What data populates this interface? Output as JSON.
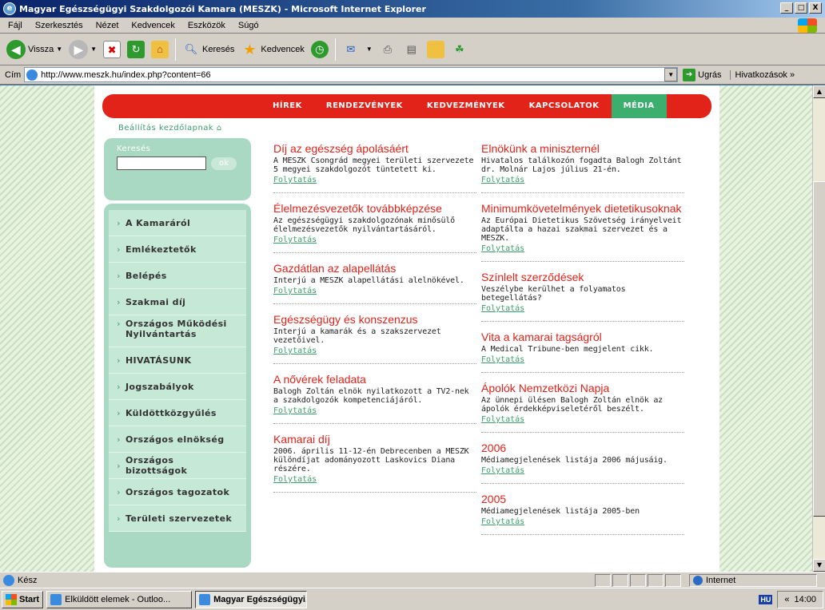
{
  "window": {
    "title": "Magyar Egészségügyi Szakdolgozói Kamara (MESZK) - Microsoft Internet Explorer",
    "minimize": "_",
    "maximize": "□",
    "close": "X"
  },
  "menu": [
    "Fájl",
    "Szerkesztés",
    "Nézet",
    "Kedvencek",
    "Eszközök",
    "Súgó"
  ],
  "toolbar": {
    "back_label": "Vissza",
    "search_label": "Keresés",
    "favorites_label": "Kedvencek"
  },
  "address": {
    "label": "Cím",
    "url": "http://www.meszk.hu/index.php?content=66",
    "go_label": "Ugrás",
    "links_label": "Hivatkozások",
    "links_more": "»"
  },
  "topnav": {
    "items": [
      {
        "label": "HÍREK",
        "active": false
      },
      {
        "label": "RENDEZVÉNYEK",
        "active": false
      },
      {
        "label": "KEDVEZMÉNYEK",
        "active": false
      },
      {
        "label": "KAPCSOLATOK",
        "active": false
      },
      {
        "label": "MÉDIA",
        "active": true
      }
    ]
  },
  "homepage_link": "Beállítás kezdőlapnak",
  "search": {
    "label": "Keresés",
    "button": "ok"
  },
  "sidebar": {
    "items": [
      "A Kamaráról",
      "Emlékeztetők",
      "Belépés",
      "Szakmai díj",
      "Országos Működési Nyilvántartás",
      "HIVATÁSUNK",
      "Jogszabályok",
      "Küldöttközgyűlés",
      "Országos elnökség",
      "Országos bizottságok",
      "Országos tagozatok",
      "Területi szervezetek"
    ]
  },
  "news": {
    "more_label": "Folytatás",
    "left": [
      {
        "title": "Díj az egészség ápolásáért",
        "body": "A MESZK Csongrád megyei területi szervezete 5 megyei szakdolgozót tüntetett ki."
      },
      {
        "title": "Élelmezésvezetők továbbképzése",
        "body": "Az egészségügyi szakdolgozónak minősülő élelmezésvezetők nyilvántartásáról."
      },
      {
        "title": "Gazdátlan az alapellátás",
        "body": "Interjú a MESZK alapellátási alelnökével."
      },
      {
        "title": "Egészségügy és konszenzus",
        "body": "Interjú a kamarák és a szakszervezet vezetőivel."
      },
      {
        "title": "A nővérek feladata",
        "body": "Balogh Zoltán elnök nyilatkozott a TV2-nek a szakdolgozók kompetenciájáról."
      },
      {
        "title": "Kamarai díj",
        "body": "2006. április 11-12-én Debrecenben a MESZK különdíjat adományozott Laskovics Diana részére."
      }
    ],
    "right": [
      {
        "title": "Elnökünk a miniszternél",
        "body": "Hivatalos találkozón fogadta Balogh Zoltánt dr. Molnár Lajos július 21-én."
      },
      {
        "title": "Minimumkövetelmények dietetikusoknak",
        "body": "Az Európai Dietetikus Szövetség irányelveit adaptálta a hazai szakmai szervezet és a MESZK."
      },
      {
        "title": "Színlelt szerződések",
        "body": "Veszélybe kerülhet a folyamatos betegellátás?"
      },
      {
        "title": "Vita a kamarai tagságról",
        "body": "A Medical Tribune-ben megjelent cikk."
      },
      {
        "title": "Ápolók Nemzetközi Napja",
        "body": "Az ünnepi ülésen Balogh Zoltán elnök az ápolók érdekképviseletéről beszélt."
      },
      {
        "title": "2006",
        "body": "Médiamegjelenések listája 2006 májusáig."
      },
      {
        "title": "2005",
        "body": "Médiamegjelenések listája 2005-ben"
      }
    ]
  },
  "status": {
    "text": "Kész",
    "zone": "Internet"
  },
  "taskbar": {
    "start": "Start",
    "tasks": [
      "Elküldött elemek - Outloo...",
      "Magyar Egészségügyi..."
    ],
    "lang": "HU",
    "tray_arrow": "«",
    "clock": "14:00"
  }
}
